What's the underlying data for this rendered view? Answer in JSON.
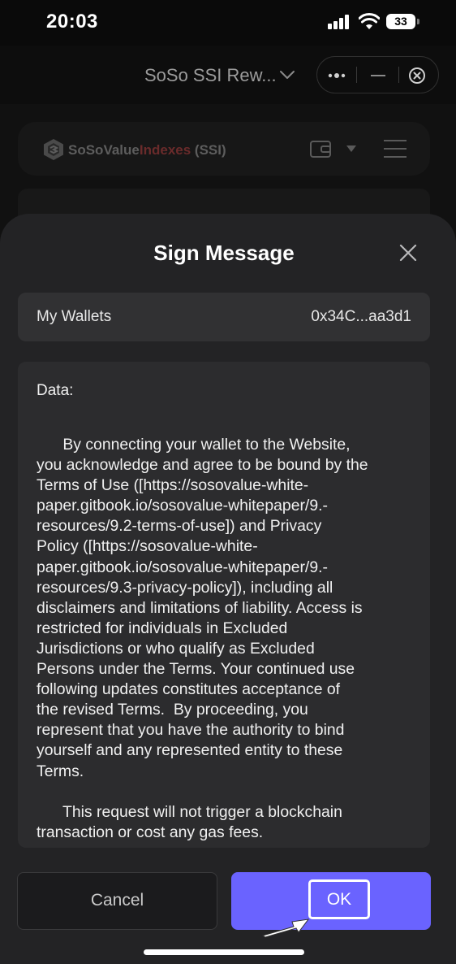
{
  "status_bar": {
    "time": "20:03",
    "battery": "33"
  },
  "browser": {
    "site_title": "SoSo SSI Rew..."
  },
  "page": {
    "logo_main": "SoSoValue",
    "logo_accent": "Indexes",
    "logo_suffix": " (SSI)"
  },
  "modal": {
    "title": "Sign Message",
    "wallet_label": "My Wallets",
    "wallet_address": "0x34C...aa3d1",
    "data_label": "Data:",
    "message_lines": [
      "      By connecting your wallet to the Website,",
      "you acknowledge and agree to be bound by the",
      "Terms of Use ([https://sosovalue-white-",
      "paper.gitbook.io/sosovalue-whitepaper/9.-",
      "resources/9.2-terms-of-use]) and Privacy",
      "Policy ([https://sosovalue-white-",
      "paper.gitbook.io/sosovalue-whitepaper/9.-",
      "resources/9.3-privacy-policy]), including all",
      "disclaimers and limitations of liability. Access is",
      "restricted for individuals in Excluded",
      "Jurisdictions or who qualify as Excluded",
      "Persons under the Terms. Your continued use",
      "following updates constitutes acceptance of",
      "the revised Terms.  By proceeding, you",
      "represent that you have the authority to bind",
      "yourself and any represented entity to these",
      "Terms."
    ],
    "message_lines_2": [
      "      This request will not trigger a blockchain",
      "transaction or cost any gas fees."
    ],
    "cancel_label": "Cancel",
    "ok_label": "OK"
  },
  "colors": {
    "accent": "#6a63ff",
    "modal_bg": "#232325"
  }
}
